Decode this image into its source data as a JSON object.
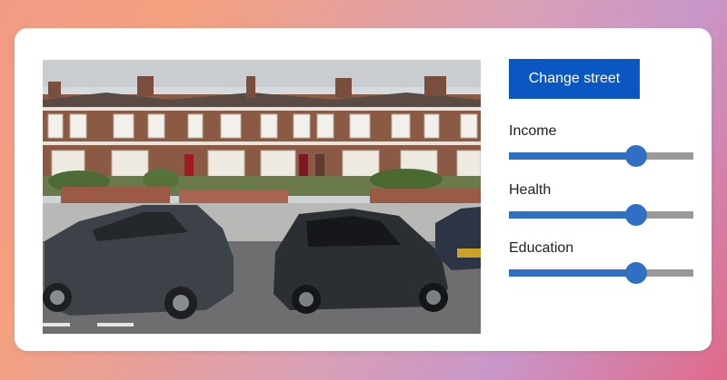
{
  "photo": {
    "alt_subject": "street-view-terraced-houses"
  },
  "controls": {
    "change_street_label": "Change street",
    "sliders": [
      {
        "label": "Income",
        "value": 0.69
      },
      {
        "label": "Health",
        "value": 0.69
      },
      {
        "label": "Education",
        "value": 0.69
      }
    ]
  },
  "colors": {
    "button": "#0a57c2",
    "slider_active": "#2f6fc4",
    "slider_track": "#999999",
    "card": "#ffffff"
  }
}
